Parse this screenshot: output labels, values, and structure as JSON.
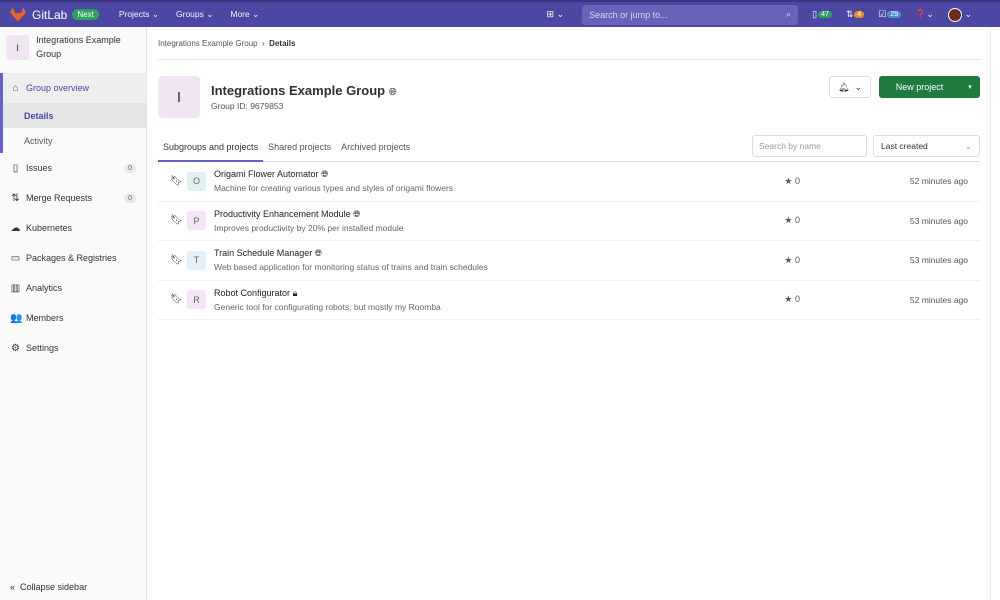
{
  "topbar": {
    "brand": "GitLab",
    "badge": "Next",
    "nav": [
      "Projects",
      "Groups",
      "More"
    ],
    "search_placeholder": "Search or jump to...",
    "issues_count": "47",
    "mr_count": "4",
    "todo_count": "29"
  },
  "sidebar": {
    "group_initial": "I",
    "group_name": "Integrations Example Group",
    "overview": "Group overview",
    "sub": [
      "Details",
      "Activity"
    ],
    "items": [
      {
        "label": "Issues",
        "count": "0"
      },
      {
        "label": "Merge Requests",
        "count": "0"
      },
      {
        "label": "Kubernetes"
      },
      {
        "label": "Packages & Registries"
      },
      {
        "label": "Analytics"
      },
      {
        "label": "Members"
      },
      {
        "label": "Settings"
      }
    ],
    "collapse": "Collapse sidebar"
  },
  "breadcrumb": [
    "Integrations Example Group",
    "Details"
  ],
  "group": {
    "initial": "I",
    "title": "Integrations Example Group",
    "id": "Group ID: 9679853"
  },
  "actions": {
    "new_project": "New project"
  },
  "tabs": [
    "Subgroups and projects",
    "Shared projects",
    "Archived projects"
  ],
  "filter": {
    "search_placeholder": "Search by name",
    "sort": "Last created"
  },
  "projects": [
    {
      "initial": "O",
      "name": "Origami Flower Automator",
      "desc": "Machine for creating various types and styles of origami flowers",
      "stars": "0",
      "time": "52 minutes ago",
      "visibility": "public",
      "color": "#e0f1ef"
    },
    {
      "initial": "P",
      "name": "Productivity Enhancement Module",
      "desc": "Improves productivity by 20% per installed module",
      "stars": "0",
      "time": "53 minutes ago",
      "visibility": "public",
      "color": "#f3e5f5"
    },
    {
      "initial": "T",
      "name": "Train Schedule Manager",
      "desc": "Web based application for monitoring status of trains and train schedules",
      "stars": "0",
      "time": "53 minutes ago",
      "visibility": "public",
      "color": "#e6f0fa"
    },
    {
      "initial": "R",
      "name": "Robot Configurator",
      "desc": "Generic tool for configurating robots, but mostly my Roomba",
      "stars": "0",
      "time": "52 minutes ago",
      "visibility": "private",
      "color": "#f3e5f5"
    }
  ]
}
